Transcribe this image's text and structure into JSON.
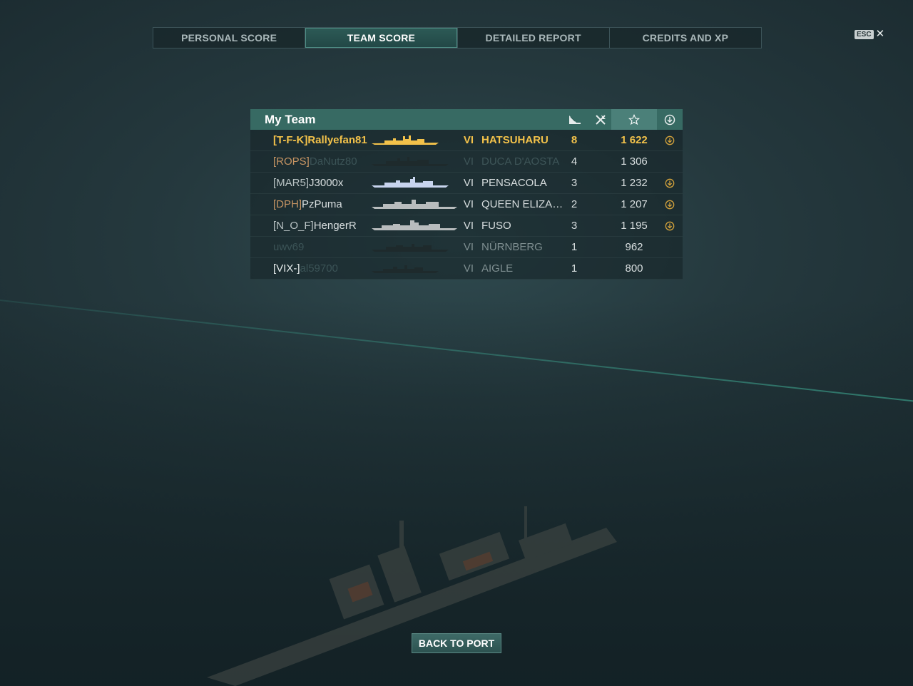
{
  "tabs": [
    {
      "label": "PERSONAL SCORE",
      "active": false
    },
    {
      "label": "TEAM SCORE",
      "active": true
    },
    {
      "label": "DETAILED REPORT",
      "active": false
    },
    {
      "label": "CREDITS AND XP",
      "active": false
    }
  ],
  "esc": {
    "key_label": "ESC",
    "close_icon": "close-icon"
  },
  "team": {
    "title": "My Team",
    "header_icons": [
      "ships-destroyed-icon",
      "planes-destroyed-icon",
      "star-icon",
      "rank-icon"
    ],
    "rows": [
      {
        "clan": "[T-F-K]",
        "player": "Rallyefan81",
        "tier": "VI",
        "ship": "HATSUHARU",
        "kills": "8",
        "score": "1 622",
        "rank_badge": true
      },
      {
        "clan": "[ROPS]",
        "player": "DaNutz80",
        "tier": "VI",
        "ship": "DUCA D'AOSTA",
        "kills": "4",
        "score": "1 306",
        "rank_badge": false
      },
      {
        "clan": "[MAR5]",
        "player": "J3000x",
        "tier": "VI",
        "ship": "PENSACOLA",
        "kills": "3",
        "score": "1 232",
        "rank_badge": true
      },
      {
        "clan": "[DPH]",
        "player": "PzPuma",
        "tier": "VI",
        "ship": "QUEEN ELIZAB...",
        "kills": "2",
        "score": "1 207",
        "rank_badge": true
      },
      {
        "clan": "[N_O_F]",
        "player": "HengerR",
        "tier": "VI",
        "ship": "FUSO",
        "kills": "3",
        "score": "1 195",
        "rank_badge": true
      },
      {
        "clan": "",
        "player": "uwv69",
        "tier": "VI",
        "ship": "NÜRNBERG",
        "kills": "1",
        "score": "962",
        "rank_badge": false
      },
      {
        "clan": "[VIX-]",
        "player": "al59700",
        "tier": "VI",
        "ship": "AIGLE",
        "kills": "1",
        "score": "800",
        "rank_badge": false
      }
    ]
  },
  "back_button": "BACK TO PORT",
  "colors": {
    "self": "#f3c24a",
    "header": "#376a63",
    "accent": "#4b8079"
  }
}
